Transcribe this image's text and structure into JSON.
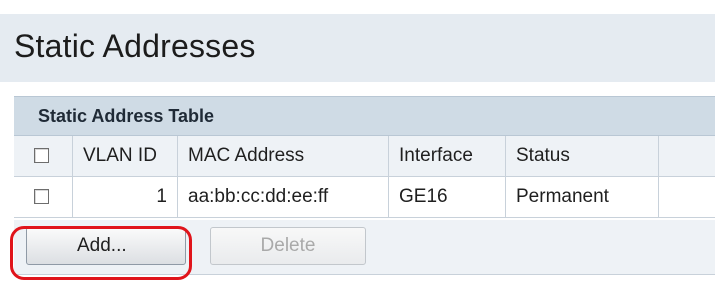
{
  "page": {
    "title": "Static Addresses"
  },
  "table": {
    "caption": "Static Address Table",
    "columns": [
      "VLAN ID",
      "MAC Address",
      "Interface",
      "Status"
    ],
    "rows": [
      {
        "vlan_id": "1",
        "mac_address": "aa:bb:cc:dd:ee:ff",
        "interface": "GE16",
        "status": "Permanent",
        "checked": false
      }
    ],
    "select_all_checked": false
  },
  "actions": {
    "add_label": "Add...",
    "delete_label": "Delete",
    "delete_enabled": false
  },
  "colors": {
    "title_bar": "#e5ebf1",
    "caption_bar": "#cfdbe5",
    "highlight": "#e0141b"
  },
  "icons": {
    "checkbox": "checkbox-unchecked-icon"
  }
}
